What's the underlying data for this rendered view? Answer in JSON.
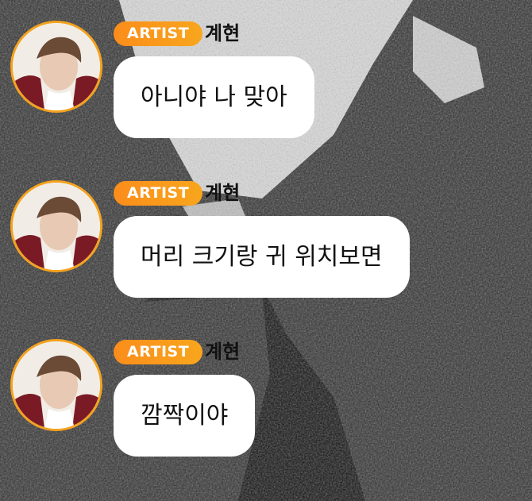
{
  "messages": [
    {
      "badge": "ARTIST",
      "name": "계현",
      "text": "아니야 나 맞아"
    },
    {
      "badge": "ARTIST",
      "name": "계현",
      "text": "머리 크기랑 귀 위치보면"
    },
    {
      "badge": "ARTIST",
      "name": "계현",
      "text": "깜짝이야"
    }
  ],
  "colors": {
    "badge_start": "#fb8d1b",
    "badge_end": "#f8a61d",
    "avatar_ring": "#f4a21f",
    "bubble": "#ffffff"
  }
}
